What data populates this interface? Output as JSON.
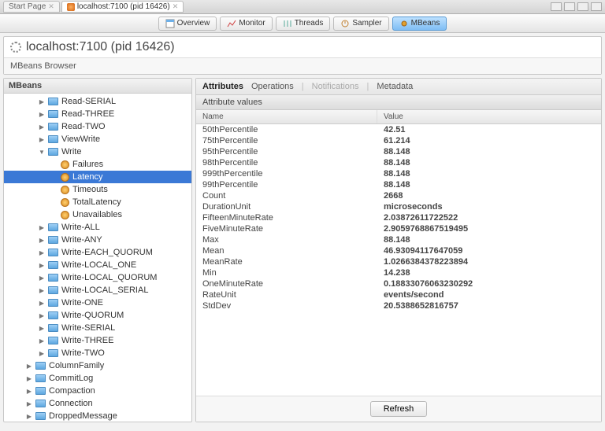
{
  "tabs": {
    "start": "Start Page",
    "active": "localhost:7100 (pid 16426)"
  },
  "toolbar": {
    "overview": "Overview",
    "monitor": "Monitor",
    "threads": "Threads",
    "sampler": "Sampler",
    "mbeans": "MBeans"
  },
  "header": {
    "title": "localhost:7100 (pid 16426)",
    "subtitle": "MBeans Browser"
  },
  "leftPane": {
    "title": "MBeans"
  },
  "tree": [
    {
      "d": 2,
      "ic": "folder",
      "exp": "closed",
      "label": "Read-SERIAL"
    },
    {
      "d": 2,
      "ic": "folder",
      "exp": "closed",
      "label": "Read-THREE"
    },
    {
      "d": 2,
      "ic": "folder",
      "exp": "closed",
      "label": "Read-TWO"
    },
    {
      "d": 2,
      "ic": "folder",
      "exp": "closed",
      "label": "ViewWrite"
    },
    {
      "d": 2,
      "ic": "folder",
      "exp": "open",
      "label": "Write"
    },
    {
      "d": 3,
      "ic": "gear",
      "label": "Failures"
    },
    {
      "d": 3,
      "ic": "gear",
      "label": "Latency",
      "selected": true
    },
    {
      "d": 3,
      "ic": "gear",
      "label": "Timeouts"
    },
    {
      "d": 3,
      "ic": "gear",
      "label": "TotalLatency"
    },
    {
      "d": 3,
      "ic": "gear",
      "label": "Unavailables"
    },
    {
      "d": 2,
      "ic": "folder",
      "exp": "closed",
      "label": "Write-ALL"
    },
    {
      "d": 2,
      "ic": "folder",
      "exp": "closed",
      "label": "Write-ANY"
    },
    {
      "d": 2,
      "ic": "folder",
      "exp": "closed",
      "label": "Write-EACH_QUORUM"
    },
    {
      "d": 2,
      "ic": "folder",
      "exp": "closed",
      "label": "Write-LOCAL_ONE"
    },
    {
      "d": 2,
      "ic": "folder",
      "exp": "closed",
      "label": "Write-LOCAL_QUORUM"
    },
    {
      "d": 2,
      "ic": "folder",
      "exp": "closed",
      "label": "Write-LOCAL_SERIAL"
    },
    {
      "d": 2,
      "ic": "folder",
      "exp": "closed",
      "label": "Write-ONE"
    },
    {
      "d": 2,
      "ic": "folder",
      "exp": "closed",
      "label": "Write-QUORUM"
    },
    {
      "d": 2,
      "ic": "folder",
      "exp": "closed",
      "label": "Write-SERIAL"
    },
    {
      "d": 2,
      "ic": "folder",
      "exp": "closed",
      "label": "Write-THREE"
    },
    {
      "d": 2,
      "ic": "folder",
      "exp": "closed",
      "label": "Write-TWO"
    },
    {
      "d": 1,
      "ic": "folder",
      "exp": "closed",
      "label": "ColumnFamily"
    },
    {
      "d": 1,
      "ic": "folder",
      "exp": "closed",
      "label": "CommitLog"
    },
    {
      "d": 1,
      "ic": "folder",
      "exp": "closed",
      "label": "Compaction"
    },
    {
      "d": 1,
      "ic": "folder",
      "exp": "closed",
      "label": "Connection"
    },
    {
      "d": 1,
      "ic": "folder",
      "exp": "closed",
      "label": "DroppedMessage"
    }
  ],
  "rightTabs": {
    "attributes": "Attributes",
    "operations": "Operations",
    "notifications": "Notifications",
    "metadata": "Metadata"
  },
  "grid": {
    "title": "Attribute values",
    "cols": {
      "name": "Name",
      "value": "Value"
    },
    "rows": [
      {
        "n": "50thPercentile",
        "v": "42.51"
      },
      {
        "n": "75thPercentile",
        "v": "61.214"
      },
      {
        "n": "95thPercentile",
        "v": "88.148"
      },
      {
        "n": "98thPercentile",
        "v": "88.148"
      },
      {
        "n": "999thPercentile",
        "v": "88.148"
      },
      {
        "n": "99thPercentile",
        "v": "88.148"
      },
      {
        "n": "Count",
        "v": "2668"
      },
      {
        "n": "DurationUnit",
        "v": "microseconds"
      },
      {
        "n": "FifteenMinuteRate",
        "v": "2.03872611722522"
      },
      {
        "n": "FiveMinuteRate",
        "v": "2.9059768867519495"
      },
      {
        "n": "Max",
        "v": "88.148"
      },
      {
        "n": "Mean",
        "v": "46.93094117647059"
      },
      {
        "n": "MeanRate",
        "v": "1.0266384378223894"
      },
      {
        "n": "Min",
        "v": "14.238"
      },
      {
        "n": "OneMinuteRate",
        "v": "0.18833076063230292"
      },
      {
        "n": "RateUnit",
        "v": "events/second"
      },
      {
        "n": "StdDev",
        "v": "20.5388652816757"
      }
    ]
  },
  "footer": {
    "refresh": "Refresh"
  }
}
